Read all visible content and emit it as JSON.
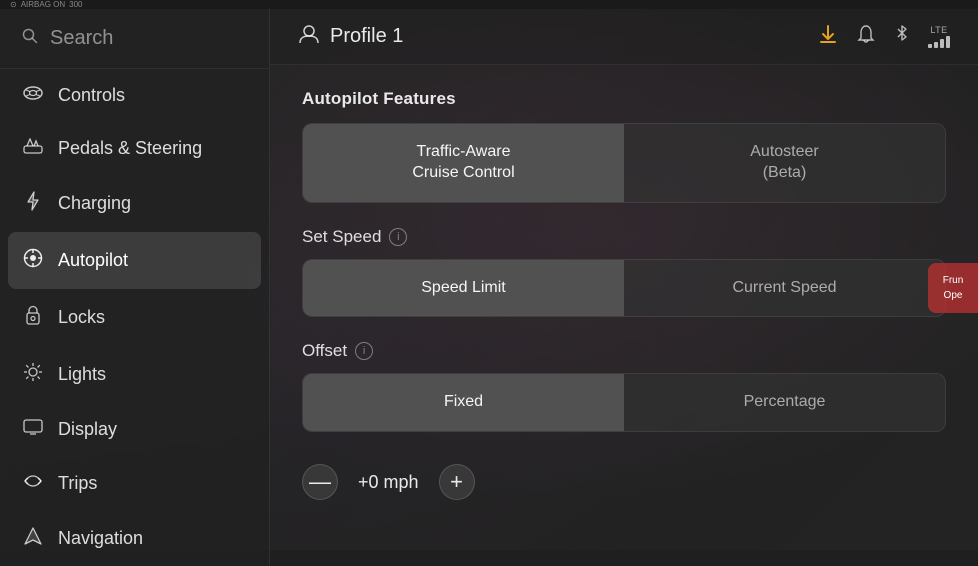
{
  "topbar": {
    "airbag_label": "AIRBAG ON",
    "speed": "300"
  },
  "sidebar": {
    "search": {
      "label": "Search"
    },
    "items": [
      {
        "id": "controls",
        "label": "Controls",
        "icon": "⊙"
      },
      {
        "id": "pedals",
        "label": "Pedals & Steering",
        "icon": "🚗"
      },
      {
        "id": "charging",
        "label": "Charging",
        "icon": "⚡"
      },
      {
        "id": "autopilot",
        "label": "Autopilot",
        "icon": "🎯",
        "active": true
      },
      {
        "id": "locks",
        "label": "Locks",
        "icon": "🔒"
      },
      {
        "id": "lights",
        "label": "Lights",
        "icon": "☼"
      },
      {
        "id": "display",
        "label": "Display",
        "icon": "▭"
      },
      {
        "id": "trips",
        "label": "Trips",
        "icon": "⇌"
      },
      {
        "id": "navigation",
        "label": "Navigation",
        "icon": "▲"
      }
    ]
  },
  "header": {
    "profile_icon": "👤",
    "profile_name": "Profile 1",
    "download_icon": "⬇",
    "bell_icon": "🔔",
    "bluetooth_icon": "✱",
    "lte_label": "LTE"
  },
  "content": {
    "autopilot_section": {
      "title": "Autopilot Features",
      "options": [
        {
          "id": "tacc",
          "label": "Traffic-Aware\nCruise Control",
          "selected": true
        },
        {
          "id": "autosteer",
          "label": "Autosteer\n(Beta)",
          "selected": false
        }
      ]
    },
    "set_speed": {
      "label": "Set Speed",
      "options": [
        {
          "id": "speed_limit",
          "label": "Speed Limit",
          "selected": true
        },
        {
          "id": "current_speed",
          "label": "Current Speed",
          "selected": false
        }
      ]
    },
    "offset": {
      "label": "Offset",
      "options": [
        {
          "id": "fixed",
          "label": "Fixed",
          "selected": true
        },
        {
          "id": "percentage",
          "label": "Percentage",
          "selected": false
        }
      ]
    },
    "speed_value": {
      "minus": "—",
      "value": "+0 mph",
      "plus": "+"
    }
  },
  "right_panel": {
    "line1": "Frun",
    "line2": "Ope"
  }
}
